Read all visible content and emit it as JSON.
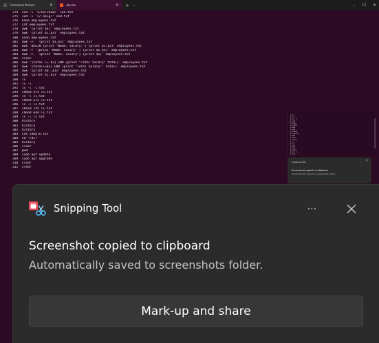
{
  "terminal": {
    "tabs": [
      {
        "label": "Command Prompt"
      },
      {
        "label": "ubuntu"
      }
    ],
    "lines": [
      "274  sed -i 's/ee/ibum/' sed.txt",
      "275  sed -i 's/ ablg/' sed.txt",
      "276  nano employees.txt",
      "277  cat employees.txt",
      "278  awk '{print $4}' employees.txt",
      "279  awk '{print $1,$3}' employees.txt",
      "280  nano employees.txt",
      "281  awk -F: '{print $1,$3}' employees.txt",
      "282  awk 'BEGIN {print \"Name: salary:\"} {print $1,$3}' employees.txt",
      "283  awk -F '{print \"Name: salary\" } {print $1 $3}' employees.txt",
      "284  awk -F, '{print \"Name: salary\"} {print $1}' employees.txt",
      "285  clear",
      "286  awk '{total += $3} END {print \"Total Salary\" total}' employees.txt",
      "287  awk '{total+=$3} END {print \"Total Salary:\" total}' employees.txt",
      "288  awk '{print $0 ,$1}' employees.txt",
      "289  awk '{print $1,$3}' employees.txt",
      "290  ls",
      "291  ls -l",
      "292  ls -l -l.txt",
      "293  chmod u+x ls.txt",
      "294  ls -l ls.txt",
      "295  chmod u+x ls.txt",
      "296  ls -l ls.txt",
      "297  chmod 755 ls.txt",
      "298  chmod 644 ls.txt",
      "299  ls -l ls.txt",
      "300  history",
      "301  history",
      "302  history",
      "303  cat sample.txt",
      "304  cd ~/dir",
      "305  history",
      "306  clear",
      "307  pwd",
      "308  sudo apt update",
      "309  sudo apt upgrade",
      "310  clear",
      "311  clear"
    ]
  },
  "notification": {
    "app_name": "Snipping Tool",
    "more_icon": "⋯",
    "title": "Screenshot copied to clipboard",
    "body": "Automatically saved to screenshots folder.",
    "action_label": "Mark-up and share"
  },
  "preview": {
    "toast_title": "Screenshot copied to clipboard",
    "toast_body": "Automatically saved to screenshots folder.",
    "app_name": "Snipping Tool"
  },
  "colors": {
    "terminal_bg": "#2d0a23",
    "toast_bg": "#2b2b2b",
    "button_bg": "#373737",
    "text_primary": "#ffffff",
    "text_secondary": "#c5c5c5"
  }
}
